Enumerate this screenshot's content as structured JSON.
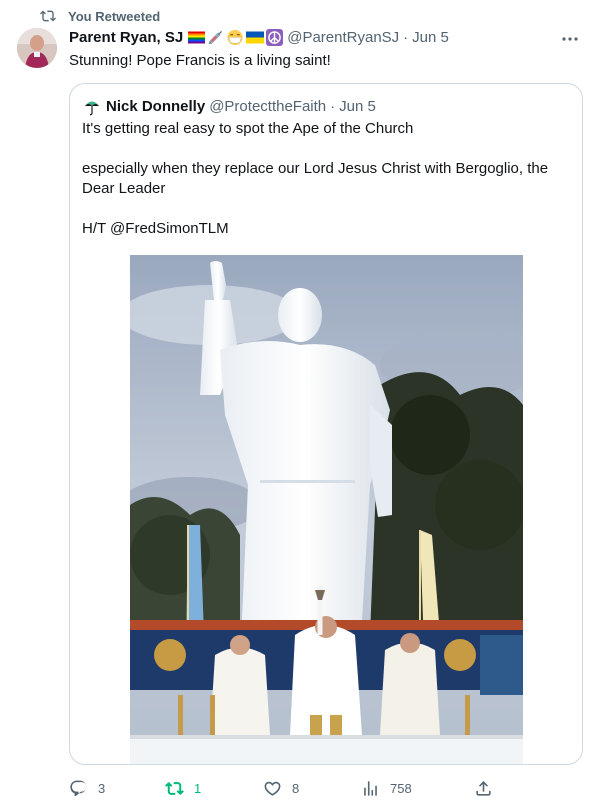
{
  "retweet_notice": {
    "label": "You Retweeted"
  },
  "tweet": {
    "author_name": "Parent Ryan, SJ",
    "handle": "@ParentRyanSJ",
    "date": "Jun 5",
    "separator": "·",
    "text": "Stunning! Pope Francis is a living saint!",
    "name_emojis": [
      "rainbow-flag-icon",
      "syringe-icon",
      "mask-face-icon",
      "ukraine-flag-icon",
      "peace-symbol-icon"
    ]
  },
  "quote": {
    "author_name": "Nick Donnelly",
    "handle": "@ProtecttheFaith",
    "date": "Jun 5",
    "separator": "·",
    "lines": [
      "It's getting real easy to spot the Ape of the Church",
      "especially when they replace our Lord Jesus Christ with  Bergoglio, the Dear Leader",
      "H/T @FredSimonTLM"
    ]
  },
  "actions": {
    "reply_count": "3",
    "retweet_count": "1",
    "like_count": "8",
    "view_count": "758"
  },
  "colors": {
    "text_primary": "#0f1419",
    "text_secondary": "#536471",
    "border": "#cfd9de",
    "retweet_green": "#00ba7c"
  }
}
